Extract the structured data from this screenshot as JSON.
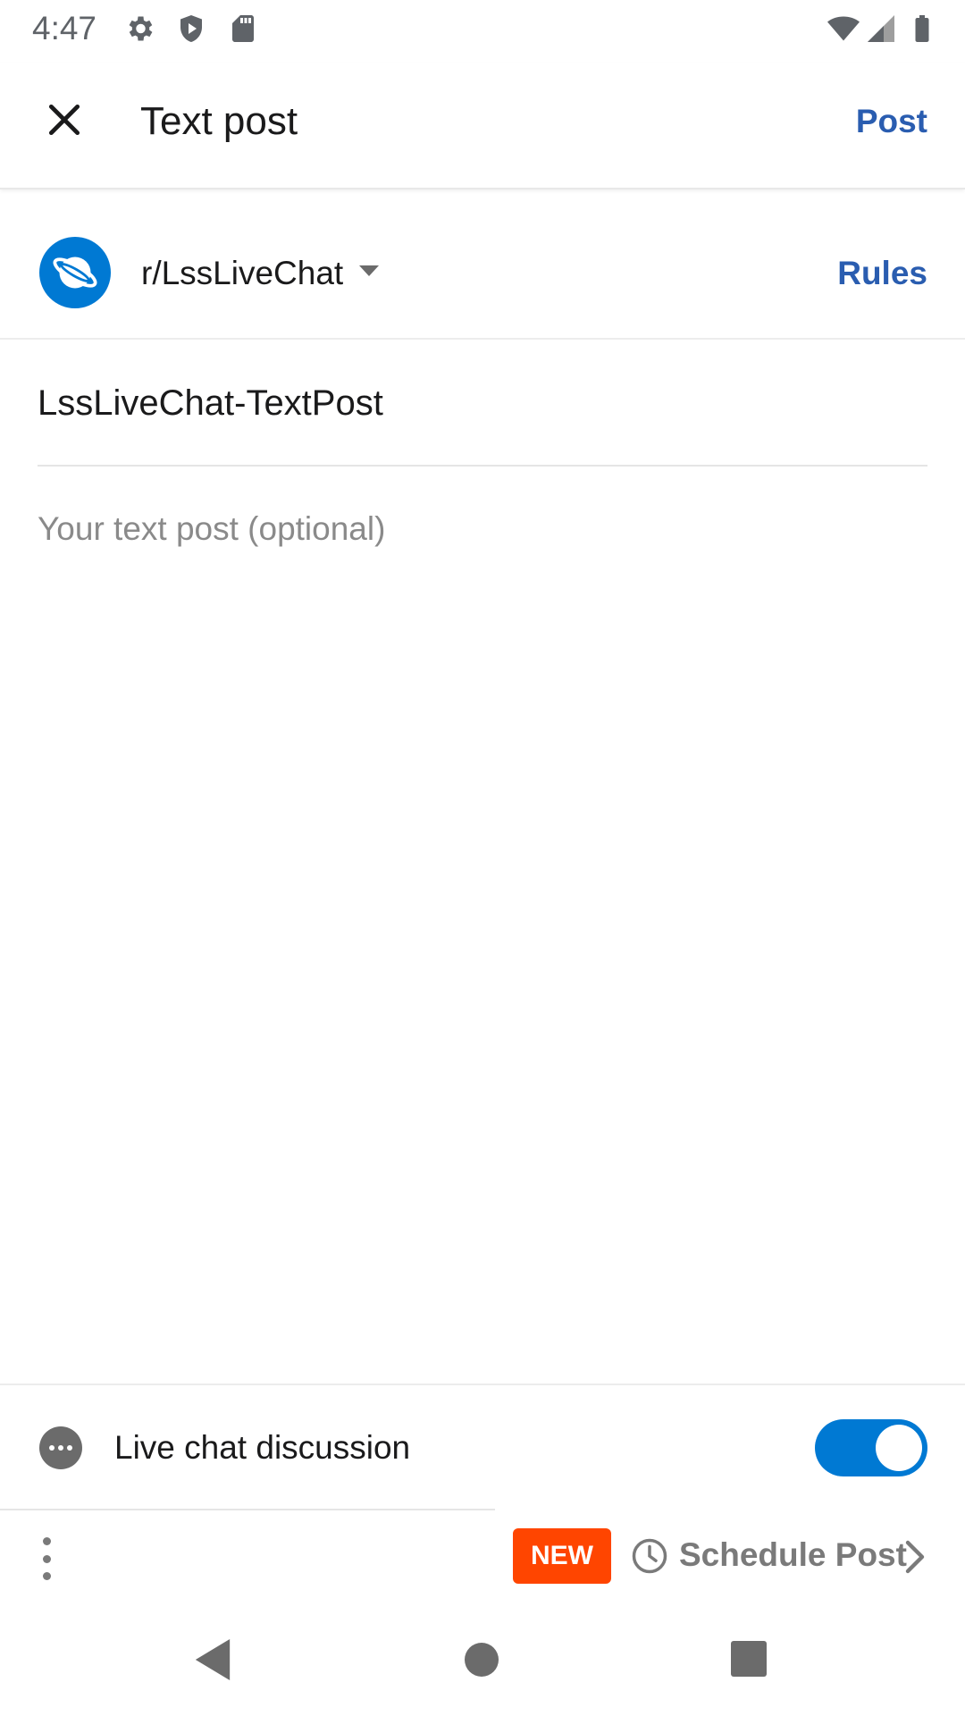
{
  "status_bar": {
    "time": "4:47",
    "icons": [
      "settings-gear-icon",
      "shield-play-icon",
      "sd-card-icon",
      "wifi-icon",
      "signal-icon",
      "battery-icon"
    ]
  },
  "header": {
    "title": "Text post",
    "post_label": "Post"
  },
  "community": {
    "name": "r/LssLiveChat",
    "rules_label": "Rules"
  },
  "composer": {
    "title_value": "LssLiveChat-TextPost",
    "body_placeholder": "Your text post (optional)"
  },
  "live_chat": {
    "label": "Live chat discussion",
    "enabled": true
  },
  "toolbar": {
    "badge": "NEW",
    "schedule_label": "Schedule Post"
  },
  "colors": {
    "accent_blue": "#2a5db0",
    "toggle_blue": "#0079d3",
    "badge_orange": "#ff4500"
  }
}
